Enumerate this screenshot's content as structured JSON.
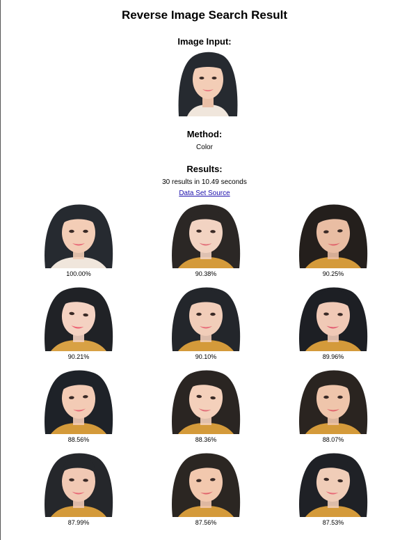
{
  "title": "Reverse Image Search Result",
  "input_label": "Image Input:",
  "method_label": "Method:",
  "method_value": "Color",
  "results_label": "Results:",
  "results_summary": "30 results in 10.49 seconds",
  "dataset_link": "Data Set Source",
  "results": [
    {
      "score": "100.00%",
      "bg": "#ffffff",
      "hair": "#262a30",
      "skin": "#f3cdb6",
      "top": "#f0e6dc",
      "lips": "#e86a78"
    },
    {
      "score": "90.38%",
      "bg": "#ffffff",
      "hair": "#2b2725",
      "skin": "#f2d3c2",
      "top": "#d49a3a",
      "lips": "#e2707a"
    },
    {
      "score": "90.25%",
      "bg": "#ffffff",
      "hair": "#241f1c",
      "skin": "#e9bda3",
      "top": "#d49a3a",
      "lips": "#e0646c"
    },
    {
      "score": "90.21%",
      "bg": "#ffffff",
      "hair": "#202226",
      "skin": "#f4d2c2",
      "top": "#d8a144",
      "lips": "#ee5e70"
    },
    {
      "score": "90.10%",
      "bg": "#ffffff",
      "hair": "#23262b",
      "skin": "#f1cdb9",
      "top": "#d49a3a",
      "lips": "#e86a78"
    },
    {
      "score": "89.96%",
      "bg": "#ffffff",
      "hair": "#1d1f24",
      "skin": "#f0c9b6",
      "top": "#d49a3a",
      "lips": "#e25a70"
    },
    {
      "score": "88.56%",
      "bg": "#ffffff",
      "hair": "#1e2228",
      "skin": "#f3cbb5",
      "top": "#d49a3a",
      "lips": "#e86a78"
    },
    {
      "score": "88.36%",
      "bg": "#ffffff",
      "hair": "#2a2522",
      "skin": "#f4d0bb",
      "top": "#d49a3a",
      "lips": "#e2707a"
    },
    {
      "score": "88.07%",
      "bg": "#ffffff",
      "hair": "#2a2420",
      "skin": "#efc5ab",
      "top": "#d49a3a",
      "lips": "#e0646c"
    },
    {
      "score": "87.99%",
      "bg": "#ffffff",
      "hair": "#25272b",
      "skin": "#f1c9b4",
      "top": "#d49a3a",
      "lips": "#e86a78"
    },
    {
      "score": "87.56%",
      "bg": "#ffffff",
      "hair": "#2b2622",
      "skin": "#f2c8ae",
      "top": "#d49a3a",
      "lips": "#e0646c"
    },
    {
      "score": "87.53%",
      "bg": "#ffffff",
      "hair": "#1f2126",
      "skin": "#f0cdb8",
      "top": "#d49a3a",
      "lips": "#e86a78"
    }
  ]
}
